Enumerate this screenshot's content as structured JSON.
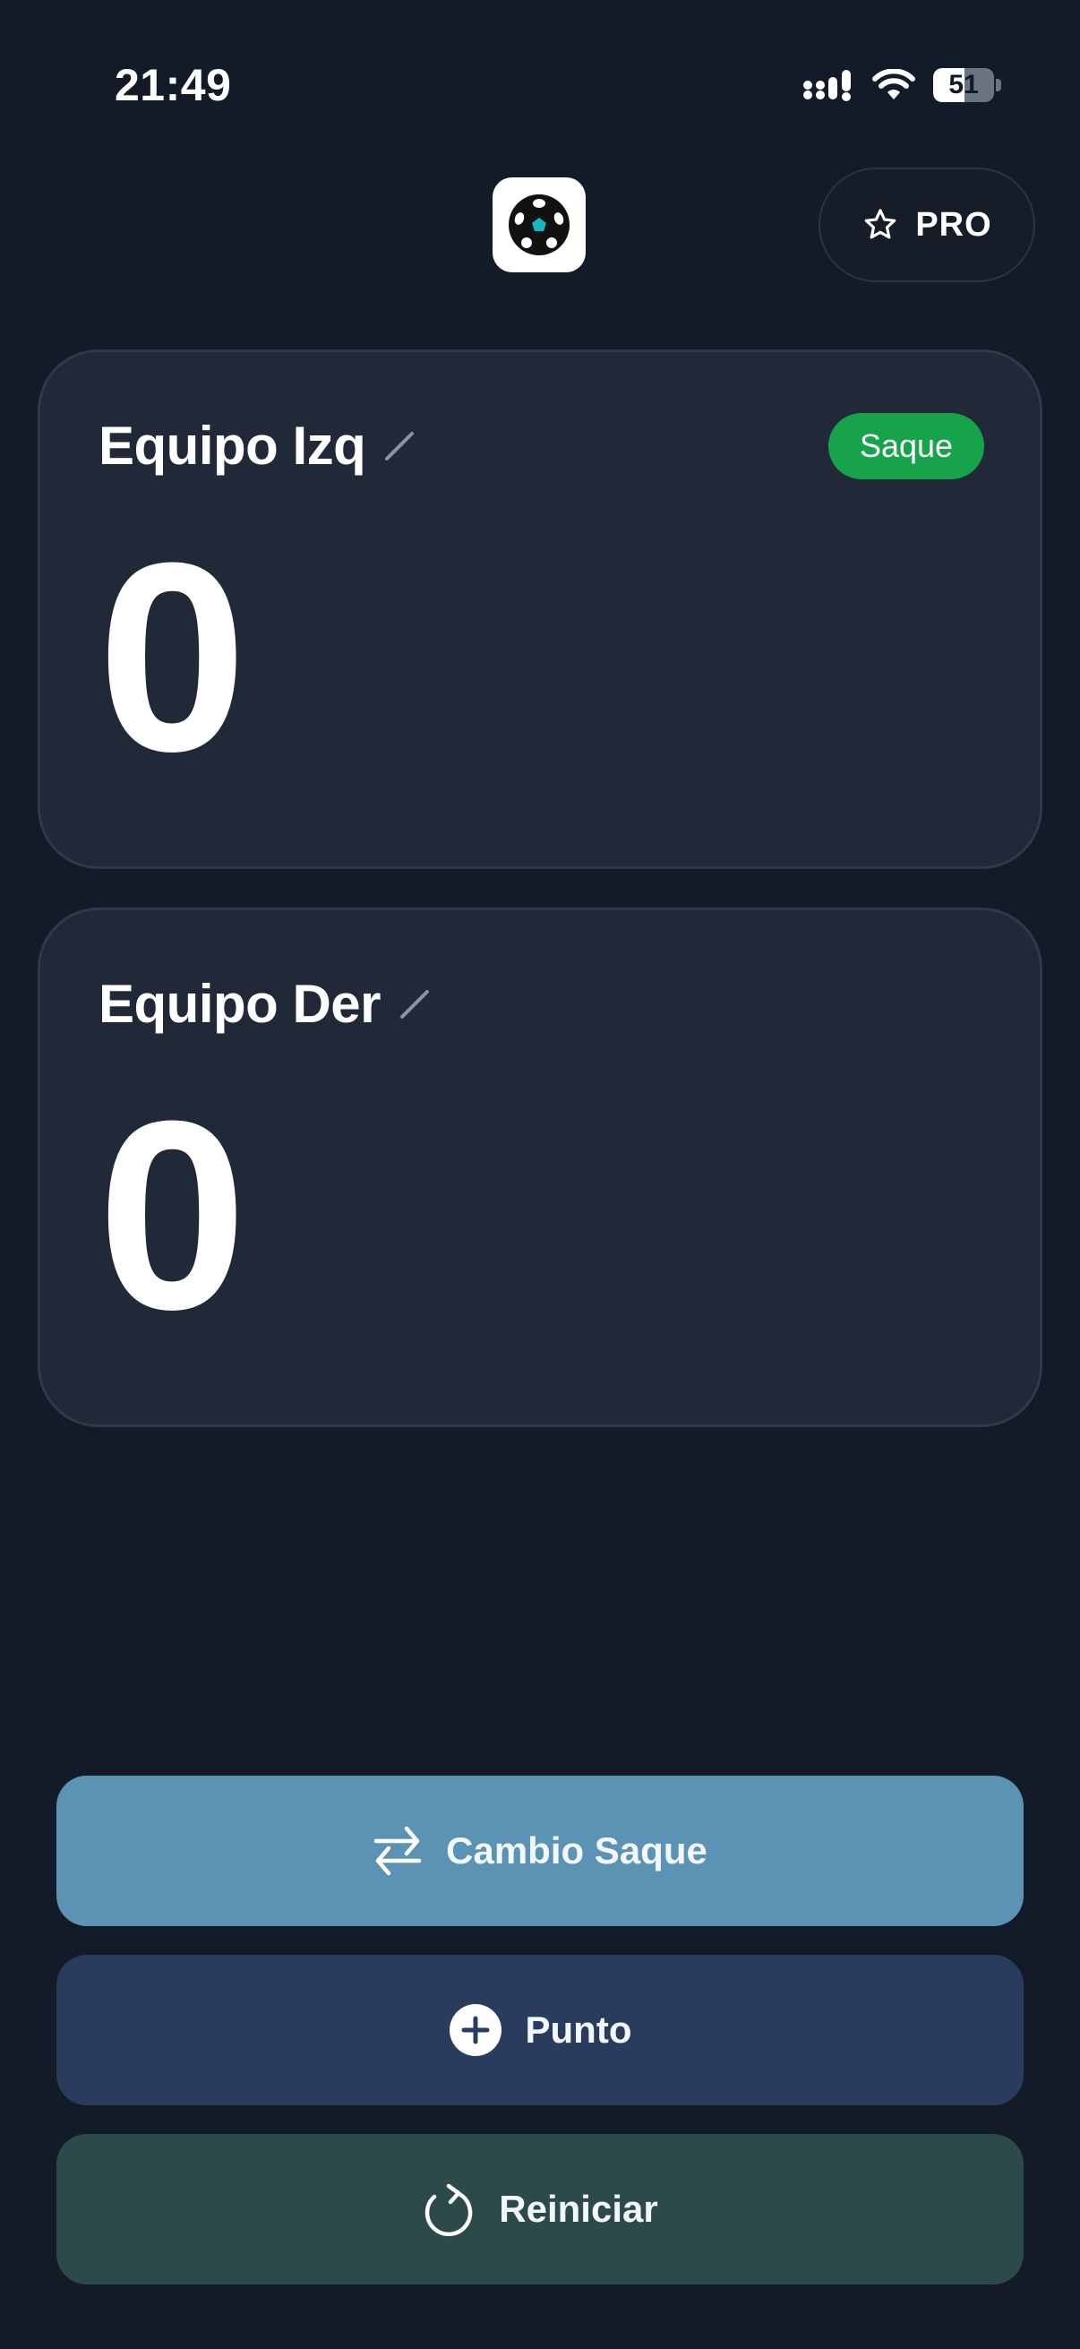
{
  "status_bar": {
    "time": "21:49",
    "battery": "51",
    "battery_level": 0.51
  },
  "header": {
    "logo_icon": "soccer-ball-icon",
    "pro_label": "PRO",
    "pro_icon": "star-outline-icon"
  },
  "teams": [
    {
      "name": "Equipo Izq",
      "score": "0",
      "serve_badge": "Saque",
      "has_serve": true
    },
    {
      "name": "Equipo Der",
      "score": "0",
      "has_serve": false
    }
  ],
  "actions": {
    "swap_serve": {
      "label": "Cambio Saque",
      "icon": "swap-arrows-icon",
      "color": "#5a93b4"
    },
    "point": {
      "label": "Punto",
      "icon": "plus-circle-icon",
      "color": "#293c5d"
    },
    "reset": {
      "label": "Reiniciar",
      "icon": "refresh-icon",
      "color": "#2c4a4a"
    }
  },
  "colors": {
    "background": "#131a28",
    "card": "#212938",
    "serve_badge": "#16a34a"
  }
}
